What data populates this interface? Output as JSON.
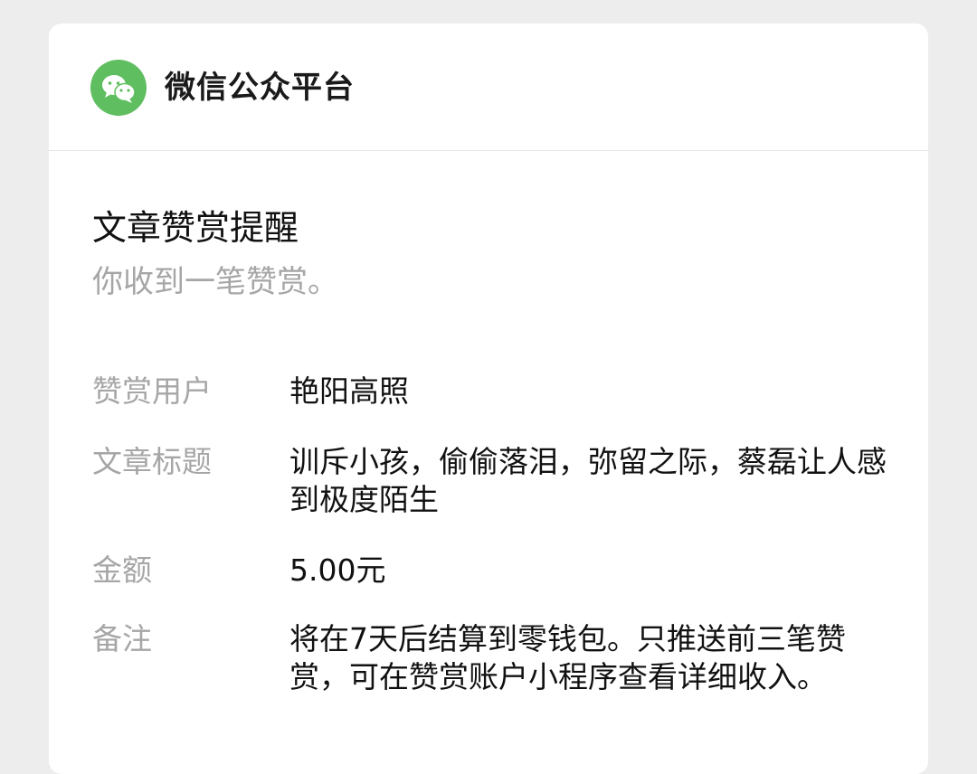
{
  "header": {
    "platform_name": "微信公众平台",
    "logo_icon": "wechat-icon",
    "logo_color": "#5fbe5f"
  },
  "message": {
    "title": "文章赞赏提醒",
    "subtitle": "你收到一笔赞赏。"
  },
  "fields": [
    {
      "label": "赞赏用户",
      "value": "艳阳高照"
    },
    {
      "label": "文章标题",
      "value": "训斥小孩，偷偷落泪，弥留之际，蔡磊让人感到极度陌生"
    },
    {
      "label": "金额",
      "value": "5.00元"
    },
    {
      "label": "备注",
      "value": "将在7天后结算到零钱包。只推送前三笔赞赏，可在赞赏账户小程序查看详细收入。"
    }
  ]
}
